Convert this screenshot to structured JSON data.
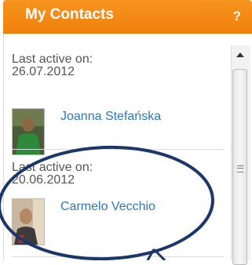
{
  "header": {
    "title": "My Contacts",
    "help_label": "?"
  },
  "contacts": [
    {
      "last_active_label": "Last active on:",
      "date": "26.07.2012",
      "name": "Joanna Stefańska"
    },
    {
      "last_active_label": "Last active on:",
      "date": "20.06.2012",
      "name": "Carmelo Vecchio"
    }
  ],
  "colors": {
    "header": "#f7941f",
    "link": "#2f77b8",
    "annotation": "#1b3668"
  },
  "icons": [
    "help-icon",
    "scroll-up-arrow-icon",
    "scroll-grip-icon",
    "annotation-arrow-icon"
  ]
}
